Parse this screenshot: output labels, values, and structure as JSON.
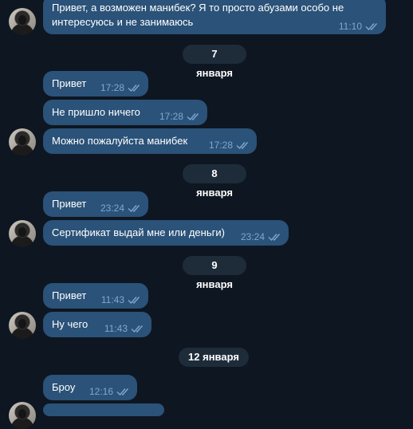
{
  "messages": [
    {
      "line1": "Привет, а возможен манибек? Я то просто абузами особо не",
      "line2": "интересуюсь и не занимаюсь",
      "time": "11:10"
    },
    {
      "text": "Привет",
      "time": "17:28"
    },
    {
      "text": "Не пришло ничего",
      "time": "17:28"
    },
    {
      "text": "Можно пожалуйста манибек",
      "time": "17:28"
    },
    {
      "text": "Привет",
      "time": "23:24"
    },
    {
      "text": "Сертификат выдай мне или деньги)",
      "time": "23:24"
    },
    {
      "text": "Привет",
      "time": "11:43"
    },
    {
      "text": "Ну чего",
      "time": "11:43"
    },
    {
      "text": "Броу",
      "time": "12:16"
    }
  ],
  "dates": [
    "7 января",
    "8 января",
    "9 января",
    "12 января"
  ],
  "icons": {
    "read_status": "double-check-icon",
    "avatar": "user-avatar"
  },
  "colors": {
    "background": "#0e1621",
    "bubble": "#2b5278",
    "meta": "#7da8d3",
    "date_pill": "#1e2c3a"
  }
}
